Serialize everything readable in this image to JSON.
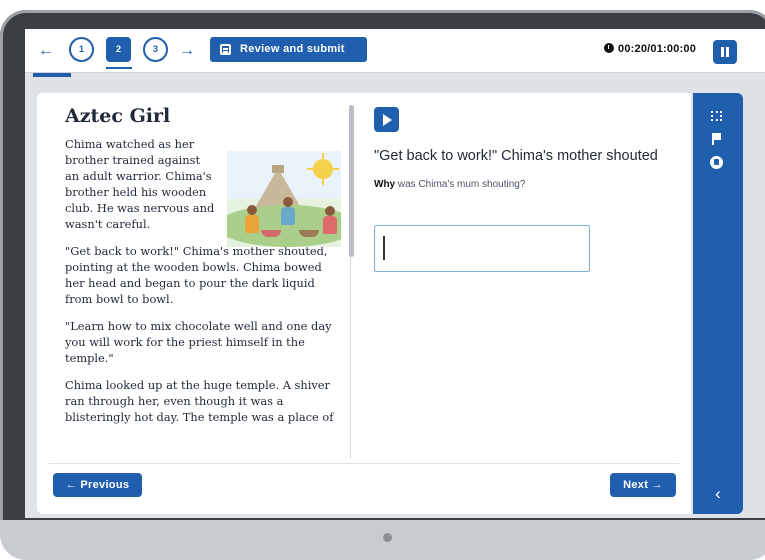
{
  "header": {
    "back_arrow": "←",
    "questions": [
      "1",
      "2",
      "3"
    ],
    "active_question": "2",
    "forward_arrow": "→",
    "review_label": "Review and submit",
    "timer": "00:20/01:00:00"
  },
  "passage": {
    "title": "Aztec Girl",
    "paragraphs": [
      "Chima watched as her brother trained against an adult warrior. Chima's brother held his wooden club. He was nervous and wasn't careful.",
      "\"Get back to work!\" Chima's mother shouted, pointing at the wooden bowls. Chima bowed her head and began to pour the dark liquid from bowl to bowl.",
      "\"Learn how to mix chocolate well and one day you will work for the priest himself in the temple.\"",
      "Chima looked up at the huge temple. A shiver ran through her, even though it was a blisteringly hot day. The temple was a place of"
    ]
  },
  "question": {
    "quote": "\"Get back to work!\" Chima's mother shouted",
    "prompt_bold": "Why",
    "prompt_rest": " was Chima's mum shouting?",
    "answer_value": ""
  },
  "footer": {
    "previous_label": "← Previous",
    "next_label": "Next →"
  },
  "sidebar": {
    "collapse_glyph": "‹"
  },
  "colors": {
    "brand_blue": "#1f5fae",
    "bezel": "#3b3f44",
    "answer_border": "#7fb0d9"
  }
}
